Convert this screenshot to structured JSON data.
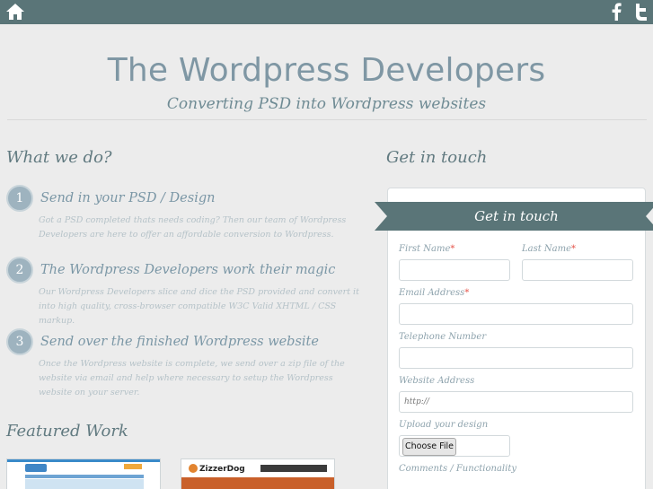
{
  "topbar": {
    "home_icon": "home-icon",
    "facebook_icon": "facebook-icon",
    "twitter_icon": "twitter-icon",
    "background": "#5a7578"
  },
  "header": {
    "title": "The Wordpress Developers",
    "tagline": "Converting PSD into Wordpress websites"
  },
  "what_we_do": {
    "heading": "What we do?",
    "steps": [
      {
        "number": "1",
        "title": "Send in your PSD / Design",
        "text": "Got a PSD completed thats needs coding? Then our team of Wordpress Developers are here to offer an affordable conversion to Wordpress."
      },
      {
        "number": "2",
        "title": "The Wordpress Developers work their magic",
        "text": "Our Wordpress Developers slice and dice the PSD provided and convert it into high quality, cross-browser compatible W3C Valid XHTML / CSS markup."
      },
      {
        "number": "3",
        "title": "Send over the finished Wordpress website",
        "text": "Once the Wordpress website is complete, we send over a zip file of the website via email and help where necessary to setup the Wordpress website on your server."
      }
    ]
  },
  "featured": {
    "heading": "Featured Work",
    "thumb2_logo": "ZizzerDog"
  },
  "contact": {
    "heading": "Get in touch",
    "ribbon_title": "Get in touch",
    "required_mark": "*",
    "first_name_label": "First Name",
    "last_name_label": "Last Name",
    "email_label": "Email Address",
    "phone_label": "Telephone Number",
    "website_label": "Website Address",
    "website_placeholder": "http://",
    "upload_label": "Upload your design",
    "choose_file": "Choose File",
    "comments_label": "Comments / Functionality"
  }
}
